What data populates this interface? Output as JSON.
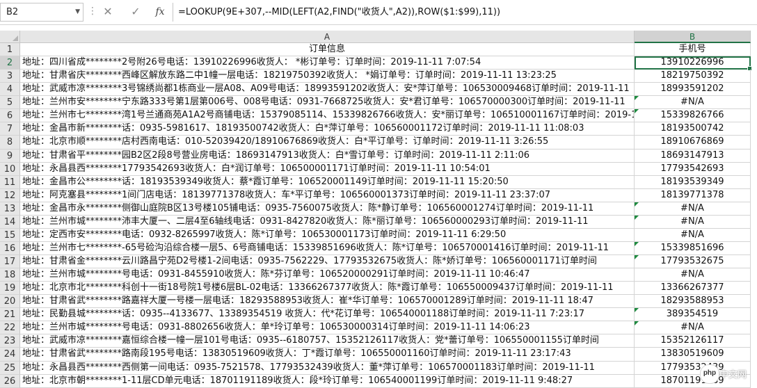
{
  "name_box": "B2",
  "formula": "=LOOKUP(9E+307,--MID(LEFT(A2,FIND(\"收货人\",A2)),ROW($1:$99),11))",
  "columns": [
    {
      "label": "A"
    },
    {
      "label": "B"
    }
  ],
  "header_row": {
    "num": "1",
    "a": "订单信息",
    "b": "手机号"
  },
  "rows": [
    {
      "num": "2",
      "a": "地址：四川省成********2号附26号电话：13910226996收货人： *彬订单号：订单时间：2019-11-11 7:07:54",
      "b": "13910226996"
    },
    {
      "num": "3",
      "a": "地址：甘肃省庆********西峰区解放东路二中1幢一层电话：18219750392收货人： *娟订单号：订单时间：2019-11-11 13:23:25",
      "b": "18219750392"
    },
    {
      "num": "4",
      "a": "地址：武威市凉********3号锦绣尚都1栋商业一层A08、A09号电话：18993591202收货人：安*萍订单号：106530009468订单时间：2019-11-11",
      "b": "18993591202"
    },
    {
      "num": "5",
      "a": "地址：兰州市安********宁东路333号第1层第006号、008号电话：0931-7668725收货人：安*君订单号：106570000300订单时间：2019-11-11",
      "b": "#N/A"
    },
    {
      "num": "6",
      "a": "地址：兰州市七********湾1号兰通商苑A1A2号商铺电话：15379085114、15339826766收货人：安*丽订单号：106510001167订单时间：2019-11-11",
      "b": "15339826766"
    },
    {
      "num": "7",
      "a": "地址：金昌市新********话：0935-5981617、18193500742收货人：白*萍订单号：106560001172订单时间：2019-11-11 11:08:03",
      "b": "18193500742"
    },
    {
      "num": "8",
      "a": "地址：北京市顺********店村西南电话：010-52039420/18910676869收货人：白*平订单号：订单时间：2019-11-11 3:26:55",
      "b": "18910676869"
    },
    {
      "num": "9",
      "a": "地址：甘肃省平********园B2区2段8号营业房电话：18693147913收货人：白*雪订单号：订单时间：2019-11-11 2:11:06",
      "b": "18693147913"
    },
    {
      "num": "10",
      "a": "地址：永昌县西********17793542693收货人：白*润订单号：106500001171订单时间：2019-11-11 10:54:01",
      "b": "17793542693"
    },
    {
      "num": "11",
      "a": "地址：金昌市公********话：18193539349收货人：蔡*霞订单号：106520001149订单时间：2019-11-11 15:20:50",
      "b": "18193539349"
    },
    {
      "num": "12",
      "a": "地址：阿克塞县********1间门店电话：18139771378收货人：车*平订单号：106560001373订单时间：2019-11-11 23:37:07",
      "b": "18139771378"
    },
    {
      "num": "13",
      "a": "地址：金昌市永********侧御山庭院B区13号楼105铺电话：0935-7560075收货人：陈*静订单号：106560001274订单时间：2019-11-11",
      "b": "#N/A"
    },
    {
      "num": "14",
      "a": "地址：兰州市城********沛丰大厦一、二层4至6轴线电话：0931-8427820收货人：陈*丽订单号：106560000293订单时间：2019-11-11",
      "b": "#N/A"
    },
    {
      "num": "15",
      "a": "地址：定西市安********电话：0932-8265997收货人：陈*订单号：106530001173订单时间：2019-11-11 6:29:50",
      "b": "#N/A"
    },
    {
      "num": "16",
      "a": "地址：兰州市七********-65号硷沟沿综合楼一层5、6号商铺电话：15339851696收货人：陈*订单号：106570001416订单时间：2019-11-11",
      "b": "15339851696"
    },
    {
      "num": "17",
      "a": "地址：甘肃省金********云川路昌宁苑D2号楼1-2间电话：0935-7562229、17793532675收货人：陈*娇订单号：106560001171订单时间",
      "b": "17793532675"
    },
    {
      "num": "18",
      "a": "地址：兰州市城********号电话：0931-8455910收货人：陈*芬订单号：106520000291订单时间：2019-11-11 10:46:47",
      "b": "#N/A"
    },
    {
      "num": "19",
      "a": "地址：北京市北********科创十一街18号院1号楼6层BL-02电话：13366267377收货人：陈*霞订单号：106550009437订单时间：2019-11-11",
      "b": "13366267377"
    },
    {
      "num": "20",
      "a": "地址：甘肃省武********路嘉祥大厦一号楼一层电话：18293588953收货人：崔*华订单号：106570001289订单时间：2019-11-11 18:47",
      "b": "18293588953"
    },
    {
      "num": "21",
      "a": "地址：民勤县城********话：0935--4133677、13389354519 收货人：代*花订单号：106540001188订单时间：2019-11-11 7:23:17",
      "b": "389354519"
    },
    {
      "num": "22",
      "a": "地址：兰州市城********号电话：0931-8802656收货人：单*玲订单号：106530000314订单时间：2019-11-11 14:06:23",
      "b": "#N/A"
    },
    {
      "num": "23",
      "a": "地址：武威市凉********嘉恒综合楼一幢一层101号电话：0935--6180757、15352126117收货人：党*蕾订单号：106550001155订单时间",
      "b": "15352126117"
    },
    {
      "num": "24",
      "a": "地址：甘肃省武********路南段195号电话：13830519609收货人：丁*霞订单号：106550001160订单时间：2019-11-11 23:17:43",
      "b": "13830519609"
    },
    {
      "num": "25",
      "a": "地址：永昌县西********西侧第一间电话：0935-7521578、17793532439收货人：董*萍订单号：106570001183订单时间：2019-11-11",
      "b": "17793532439"
    },
    {
      "num": "26",
      "a": "地址：北京市朝********1-11层CD单元电话：18701191189收货人：段*玲订单号：106540001199订单时间：2019-11-11 9:48:27",
      "b": "18701191189"
    }
  ],
  "watermark": {
    "text": "中文网"
  },
  "icons": {
    "cancel": "close-icon",
    "enter": "check-icon",
    "fx": "function-icon"
  }
}
